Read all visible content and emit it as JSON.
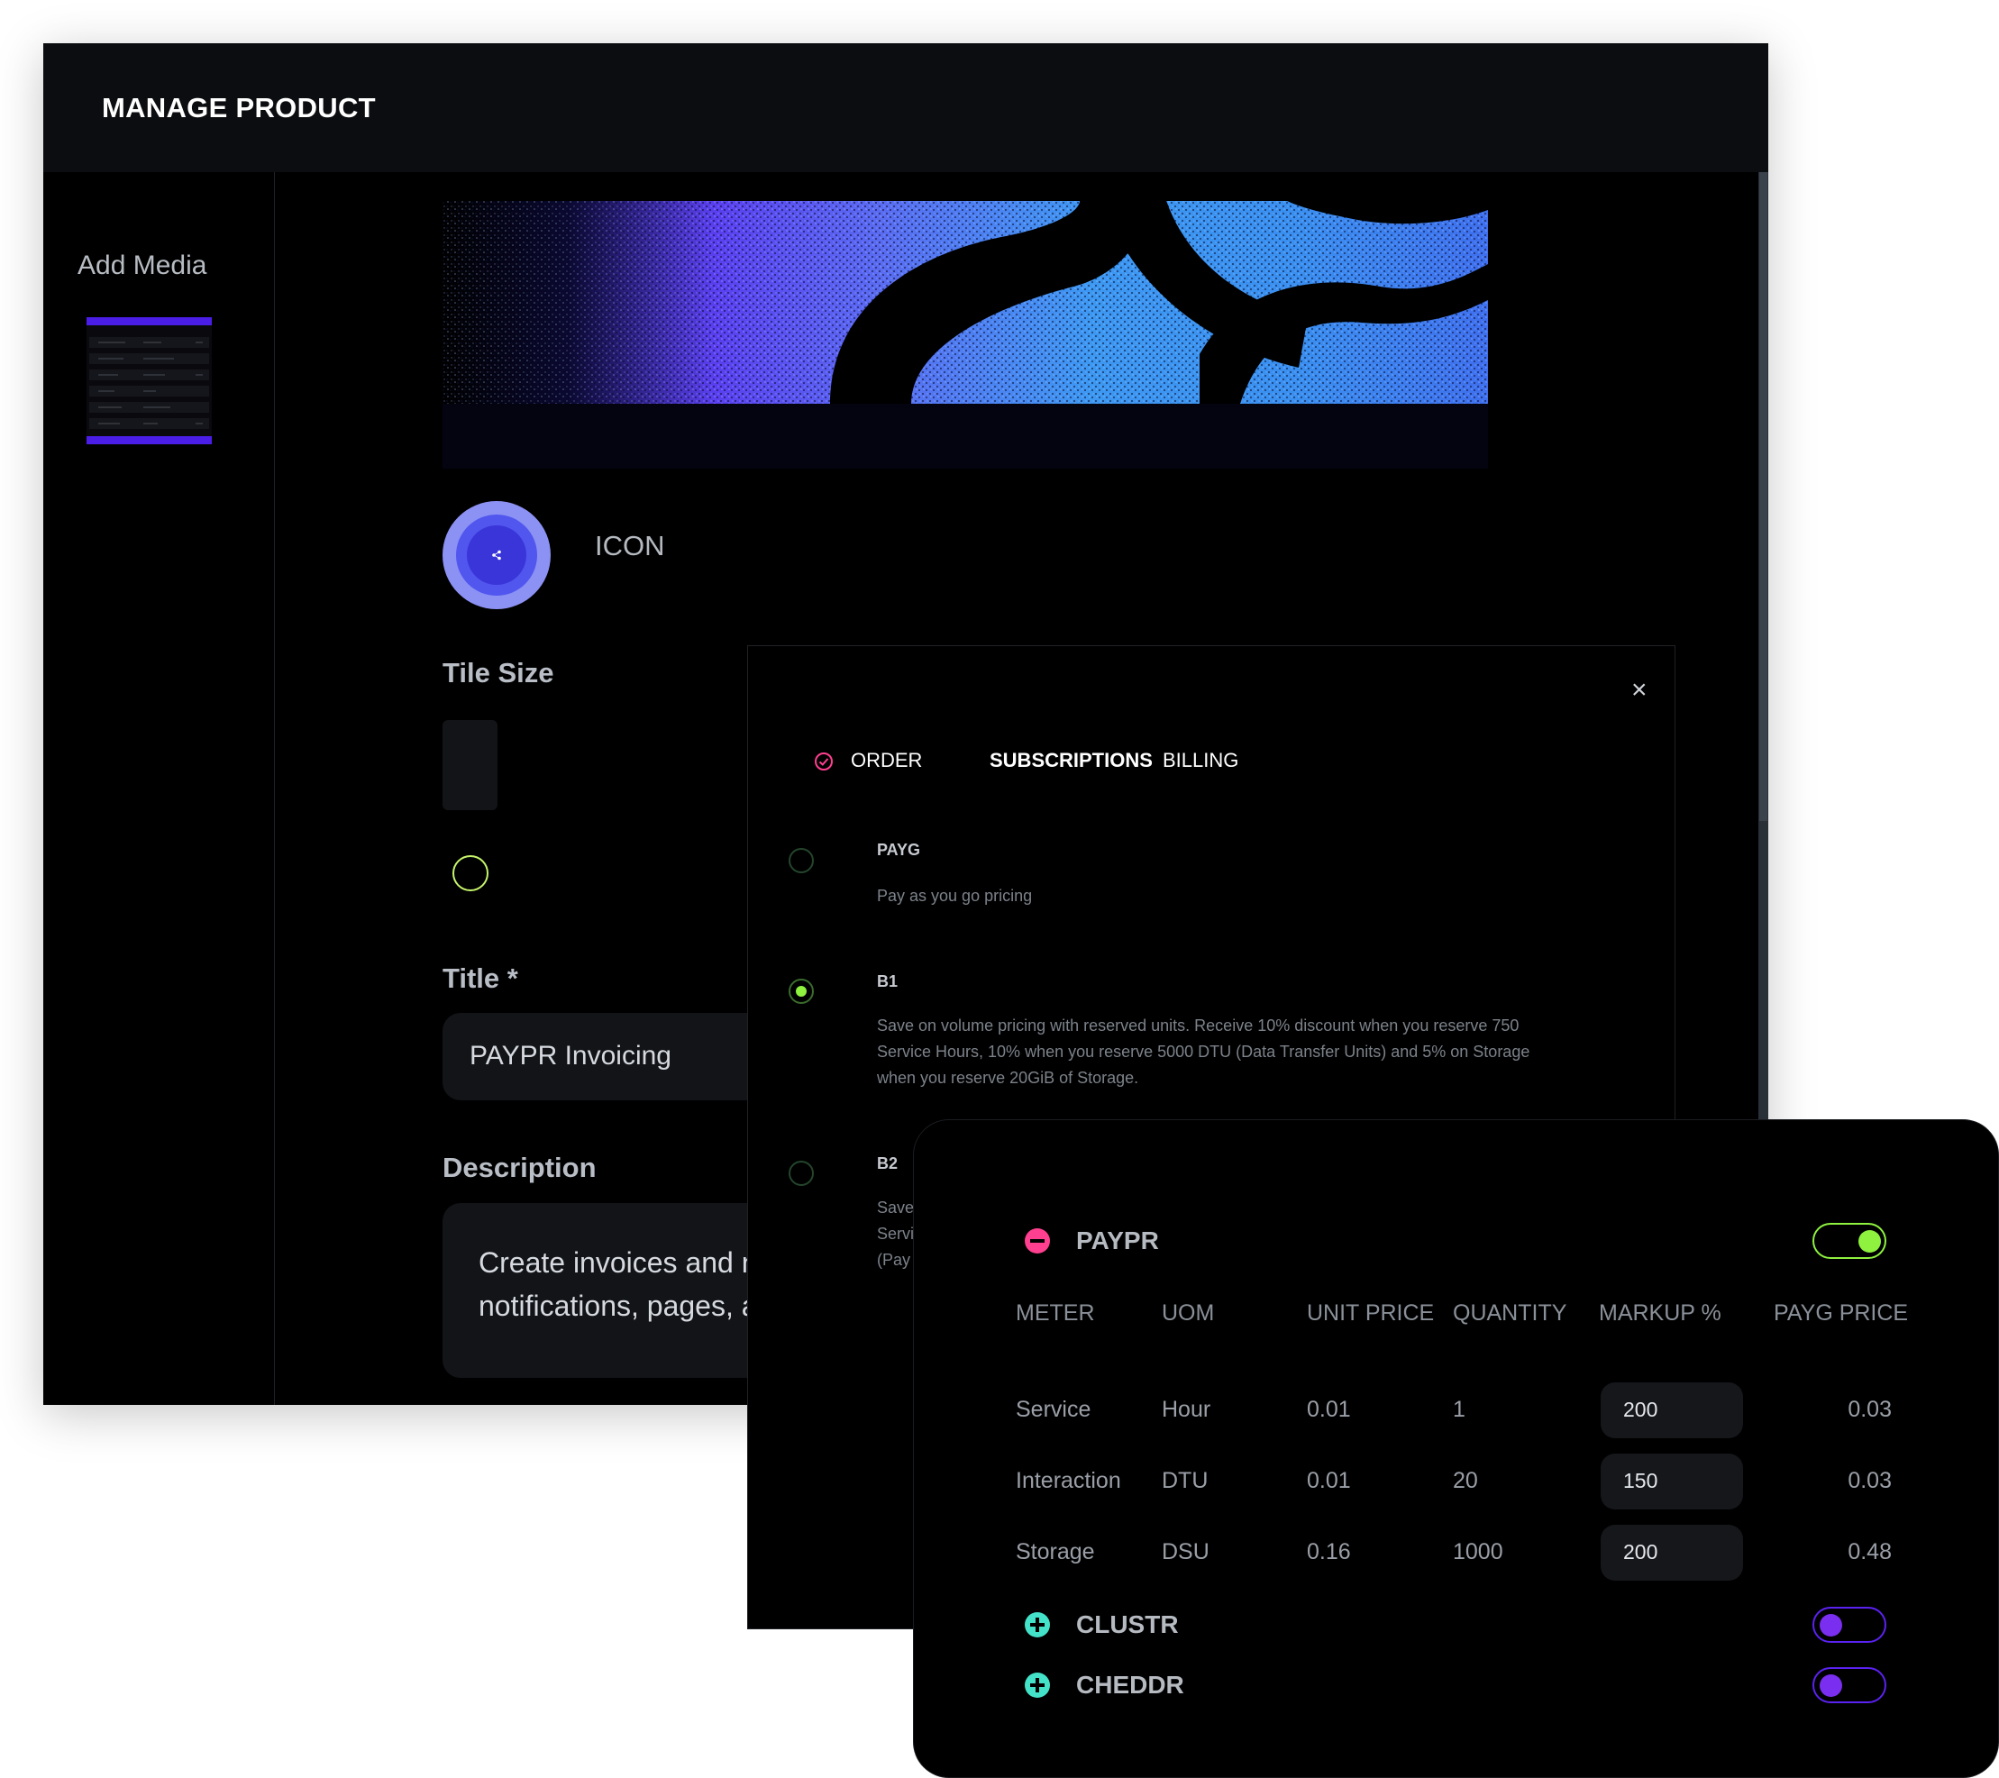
{
  "window": {
    "title": "MANAGE PRODUCT"
  },
  "sidebar": {
    "title": "Add Media"
  },
  "icon": {
    "label": "ICON",
    "glyph": "share-icon"
  },
  "form": {
    "tile_size_label": "Tile Size",
    "title_label": "Title *",
    "title_value": "PAYPR Invoicing",
    "description_label": "Description",
    "description_line1": "Create invoices and n",
    "description_line2": "notifications, pages, a"
  },
  "modal": {
    "close_label": "×",
    "tabs": [
      {
        "label": "ORDER"
      },
      {
        "label": "SUBSCRIPTIONS"
      },
      {
        "label": "BILLING"
      }
    ],
    "plans": [
      {
        "name": "PAYG",
        "description": "Pay as you go pricing",
        "selected": false
      },
      {
        "name": "B1",
        "description_lines": [
          "Save on volume pricing with reserved units. Receive 10% discount when you reserve 750",
          "Service Hours, 10% when you reserve 5000 DTU (Data Transfer Units) and 5% on Storage",
          "when you reserve 20GiB of Storage."
        ],
        "selected": true
      },
      {
        "name": "B2",
        "description_lines": [
          "Save",
          "Servi",
          "(Pay"
        ],
        "selected": false
      }
    ]
  },
  "pricing": {
    "groups": [
      {
        "name": "PAYPR",
        "expanded": true,
        "enabled": true
      },
      {
        "name": "CLUSTR",
        "expanded": false,
        "enabled": false
      },
      {
        "name": "CHEDDR",
        "expanded": false,
        "enabled": false
      }
    ],
    "columns": [
      "METER",
      "UOM",
      "UNIT PRICE",
      "QUANTITY",
      "MARKUP %",
      "PAYG PRICE"
    ],
    "rows": [
      {
        "meter": "Service",
        "uom": "Hour",
        "unit_price": "0.01",
        "quantity": "1",
        "markup": "200",
        "payg_price": "0.03"
      },
      {
        "meter": "Interaction",
        "uom": "DTU",
        "unit_price": "0.01",
        "quantity": "20",
        "markup": "150",
        "payg_price": "0.03"
      },
      {
        "meter": "Storage",
        "uom": "DSU",
        "unit_price": "0.16",
        "quantity": "1000",
        "markup": "200",
        "payg_price": "0.48"
      }
    ]
  },
  "colors": {
    "accent_purple": "#4a1ee6",
    "accent_green": "#8ef23f",
    "accent_pink": "#ff3f8f",
    "accent_teal": "#44e3c9"
  }
}
